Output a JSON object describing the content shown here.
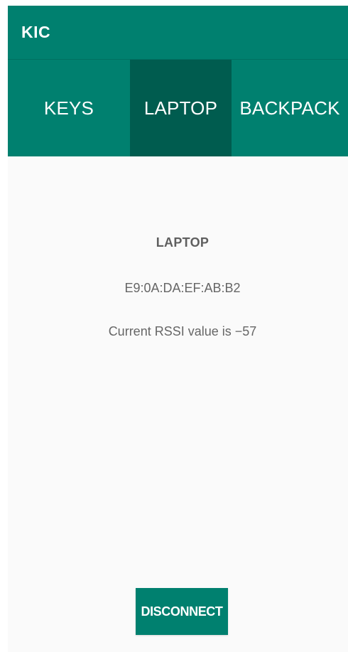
{
  "app": {
    "title": "KIC"
  },
  "tabs": [
    {
      "label": "KEYS",
      "selected": false
    },
    {
      "label": "LAPTOP",
      "selected": true
    },
    {
      "label": "BACKPACK",
      "selected": false
    }
  ],
  "device": {
    "name": "LAPTOP",
    "mac_address": "E9:0A:DA:EF:AB:B2",
    "rssi_text": "Current RSSI value is −57"
  },
  "actions": {
    "disconnect_label": "DISCONNECT"
  },
  "colors": {
    "primary": "#00806f",
    "selected_tab": "#005c4f",
    "background": "#fafafa",
    "body_text": "#666666"
  }
}
